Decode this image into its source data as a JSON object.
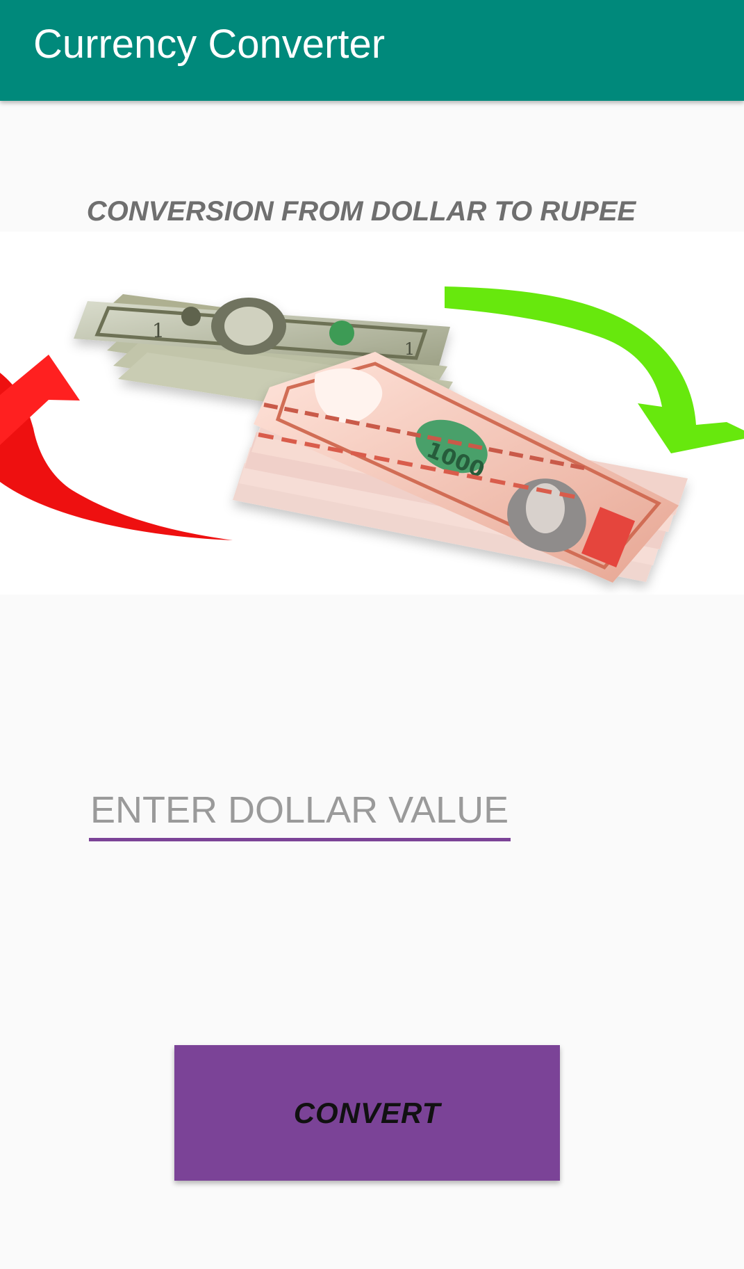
{
  "appbar": {
    "title": "Currency Converter",
    "color": "#00897b"
  },
  "main": {
    "heading": "CONVERSION FROM DOLLAR TO RUPEE",
    "hero_image": {
      "icon": "currency-exchange-illustration",
      "dollar_note_value": "1",
      "rupee_note_value": "1000"
    },
    "dollar_input": {
      "value": "",
      "placeholder": "ENTER DOLLAR VALUE($)",
      "underline_color": "#7b4397"
    },
    "convert_button": {
      "label": "CONVERT",
      "color": "#7b4397"
    }
  }
}
